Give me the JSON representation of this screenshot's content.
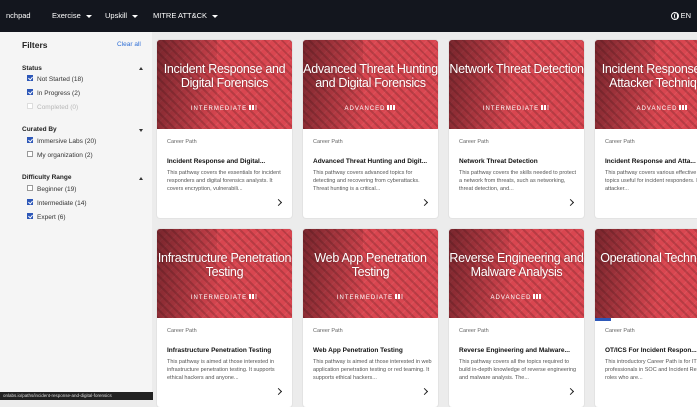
{
  "topbar": {
    "brand": "nchpad",
    "nav": [
      {
        "label": "Exercise",
        "caret": true
      },
      {
        "label": "Upskill",
        "caret": true
      },
      {
        "label": "MITRE ATT&CK",
        "caret": true
      }
    ],
    "language": "EN",
    "icons": {
      "language": "globe-icon",
      "menu_caret": "chevron-down-icon"
    }
  },
  "sidebar": {
    "title": "Filters",
    "clear_all": "Clear all",
    "groups": [
      {
        "title": "Status",
        "expanded": true,
        "options": [
          {
            "label": "Not Started (18)",
            "checked": true,
            "disabled": false
          },
          {
            "label": "In Progress (2)",
            "checked": true,
            "disabled": false
          },
          {
            "label": "Completed (0)",
            "checked": false,
            "disabled": true
          }
        ]
      },
      {
        "title": "Curated By",
        "expanded": false,
        "options": [
          {
            "label": "Immersive Labs (20)",
            "checked": true,
            "disabled": false
          },
          {
            "label": "My organization (2)",
            "checked": false,
            "disabled": false
          }
        ]
      },
      {
        "title": "Difficulty Range",
        "expanded": true,
        "options": [
          {
            "label": "Beginner (19)",
            "checked": false,
            "disabled": false
          },
          {
            "label": "Intermediate (14)",
            "checked": true,
            "disabled": false
          },
          {
            "label": "Expert (6)",
            "checked": true,
            "disabled": false
          }
        ]
      }
    ]
  },
  "tooltip": "onlabs.io/paths/incident-response-and-digital-forensics",
  "cards": [
    {
      "image_title": "Incident Response and Digital Forensics",
      "level": "INTERMEDIATE",
      "bars": 2,
      "type": "Career Path",
      "title": "Incident Response and Digital...",
      "desc": "This pathway covers the essentials for incident responders and digital forensics analysts. It covers encryption, vulnerabili..."
    },
    {
      "image_title": "Advanced Threat Hunting and Digital Forensics",
      "level": "ADVANCED",
      "bars": 3,
      "type": "Career Path",
      "title": "Advanced Threat Hunting and Digit...",
      "desc": "This pathway covers advanced topics for detecting and recovering from cyberattacks. Threat hunting is a critical..."
    },
    {
      "image_title": "Network Threat Detection",
      "level": "INTERMEDIATE",
      "bars": 2,
      "type": "Career Path",
      "title": "Network Threat Detection",
      "desc": "This pathway covers the skills needed to protect a network from threats, such as networking, threat detection, and..."
    },
    {
      "image_title": "Incident Response and Attacker Techniques",
      "level": "ADVANCED",
      "bars": 3,
      "type": "Career Path",
      "title": "Incident Response and Atta...",
      "desc": "This pathway covers various effective defensive topics useful for incident responders. It looks at attacker..."
    },
    {
      "image_title": "Infrastructure Penetration Testing",
      "level": "INTERMEDIATE",
      "bars": 2,
      "type": "Career Path",
      "title": "Infrastructure Penetration Testing",
      "desc": "This pathway is aimed at those interested in infrastructure penetration testing. It supports ethical hackers and anyone..."
    },
    {
      "image_title": "Web App Penetration Testing",
      "level": "INTERMEDIATE",
      "bars": 2,
      "type": "Career Path",
      "title": "Web App Penetration Testing",
      "desc": "This pathway is aimed at those interested in web application penetration testing or red teaming. It supports ethical hackers..."
    },
    {
      "image_title": "Reverse Engineering and Malware Analysis",
      "level": "ADVANCED",
      "bars": 3,
      "type": "Career Path",
      "title": "Reverse Engineering and Malware...",
      "desc": "This pathway covers all the topics required to build in-depth knowledge of reverse engineering and malware analysis. The..."
    },
    {
      "image_title": "Operational Technology",
      "level": "",
      "bars": 0,
      "type": "Career Path",
      "title": "OT/ICS For Incident Respon...",
      "desc": "This introductory Career Path is for IT professionals in SOC and Incident Response roles who are...",
      "progress": 0.12
    }
  ],
  "colors": {
    "accent": "#2d57b8",
    "card_art": "#d94650",
    "topbar": "#13161e",
    "link": "#2f6fd6"
  }
}
